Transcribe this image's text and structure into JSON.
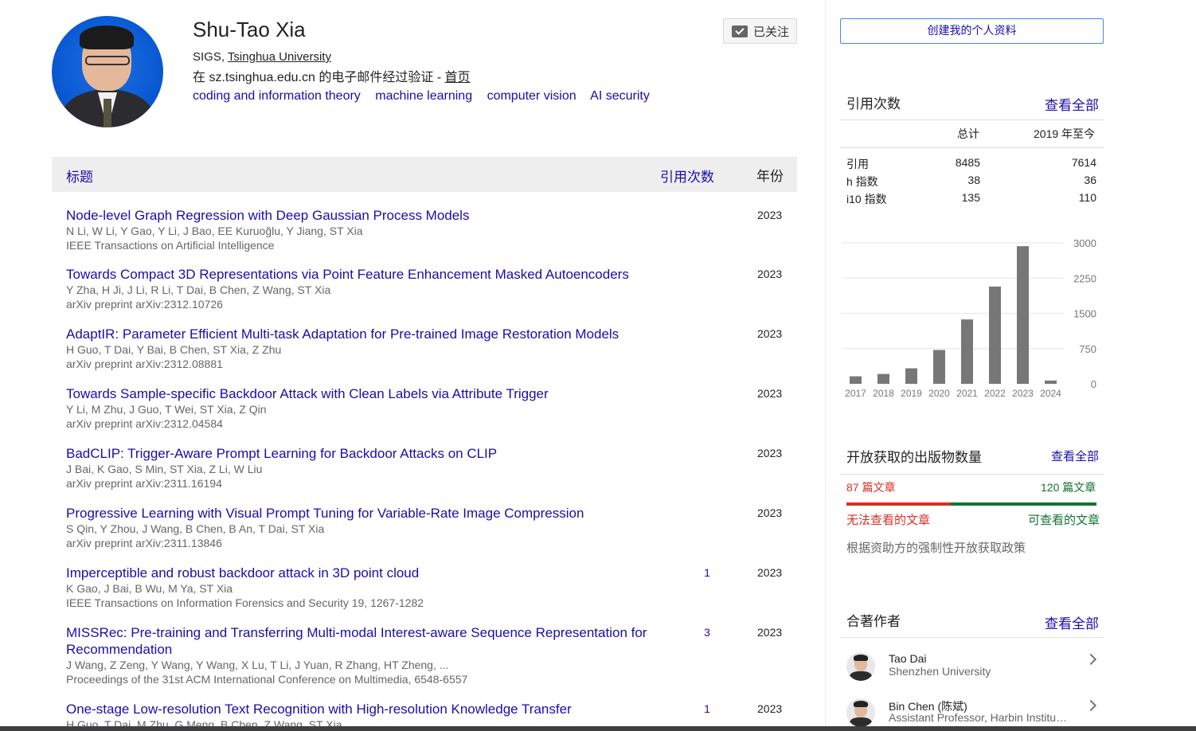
{
  "profile": {
    "name": "Shu-Tao Xia",
    "affiliation_prefix": "SIGS, ",
    "affiliation_link": "Tsinghua University",
    "verified_text": "在 sz.tsinghua.edu.cn 的电子邮件经过验证 - ",
    "homepage_link": "首页",
    "interests": [
      "coding and information theory",
      "machine learning",
      "computer vision",
      "AI security"
    ],
    "follow_label": "已关注"
  },
  "table": {
    "col_title": "标题",
    "col_citations": "引用次数",
    "col_year": "年份",
    "rows": [
      {
        "title": "Node-level Graph Regression with Deep Gaussian Process Models",
        "authors": "N Li, W Li, Y Gao, Y Li, J Bao, EE Kuruoğlu, Y Jiang, ST Xia",
        "venue": "IEEE Transactions on Artificial Intelligence",
        "citations": "",
        "year": "2023"
      },
      {
        "title": "Towards Compact 3D Representations via Point Feature Enhancement Masked Autoencoders",
        "authors": "Y Zha, H Ji, J Li, R Li, T Dai, B Chen, Z Wang, ST Xia",
        "venue": "arXiv preprint arXiv:2312.10726",
        "citations": "",
        "year": "2023"
      },
      {
        "title": "AdaptIR: Parameter Efficient Multi-task Adaptation for Pre-trained Image Restoration Models",
        "authors": "H Guo, T Dai, Y Bai, B Chen, ST Xia, Z Zhu",
        "venue": "arXiv preprint arXiv:2312.08881",
        "citations": "",
        "year": "2023"
      },
      {
        "title": "Towards Sample-specific Backdoor Attack with Clean Labels via Attribute Trigger",
        "authors": "Y Li, M Zhu, J Guo, T Wei, ST Xia, Z Qin",
        "venue": "arXiv preprint arXiv:2312.04584",
        "citations": "",
        "year": "2023"
      },
      {
        "title": "BadCLIP: Trigger-Aware Prompt Learning for Backdoor Attacks on CLIP",
        "authors": "J Bai, K Gao, S Min, ST Xia, Z Li, W Liu",
        "venue": "arXiv preprint arXiv:2311.16194",
        "citations": "",
        "year": "2023"
      },
      {
        "title": "Progressive Learning with Visual Prompt Tuning for Variable-Rate Image Compression",
        "authors": "S Qin, Y Zhou, J Wang, B Chen, B An, T Dai, ST Xia",
        "venue": "arXiv preprint arXiv:2311.13846",
        "citations": "",
        "year": "2023"
      },
      {
        "title": "Imperceptible and robust backdoor attack in 3D point cloud",
        "authors": "K Gao, J Bai, B Wu, M Ya, ST Xia",
        "venue": "IEEE Transactions on Information Forensics and Security 19, 1267-1282",
        "citations": "1",
        "year": "2023"
      },
      {
        "title": "MISSRec: Pre-training and Transferring Multi-modal Interest-aware Sequence Representation for Recommendation",
        "authors": "J Wang, Z Zeng, Y Wang, Y Wang, X Lu, T Li, J Yuan, R Zhang, HT Zheng, ...",
        "venue": "Proceedings of the 31st ACM International Conference on Multimedia, 6548-6557",
        "citations": "3",
        "year": "2023"
      },
      {
        "title": "One-stage Low-resolution Text Recognition with High-resolution Knowledge Transfer",
        "authors": "H Guo, T Dai, M Zhu, G Meng, B Chen, Z Wang, ST Xia",
        "venue": "",
        "citations": "1",
        "year": "2023"
      }
    ]
  },
  "sidebar": {
    "create_profile": "创建我的个人资料",
    "citations": {
      "title": "引用次数",
      "view_all": "查看全部",
      "col_total": "总计",
      "col_since": "2019 年至今",
      "rows": [
        {
          "label": "引用",
          "total": "8485",
          "since": "7614"
        },
        {
          "label": "h 指数",
          "total": "38",
          "since": "36"
        },
        {
          "label": "i10 指数",
          "total": "135",
          "since": "110"
        }
      ]
    },
    "open_access": {
      "title": "开放获取的出版物数量",
      "view_all": "查看全部",
      "unavailable_count": "87 篇文章",
      "available_count": "120 篇文章",
      "unavailable_label": "无法查看的文章",
      "available_label": "可查看的文章",
      "mandate_text": "根据资助方的强制性开放获取政策",
      "unavailable_fraction": 0.42
    },
    "coauthors": {
      "title": "合著作者",
      "view_all": "查看全部",
      "people": [
        {
          "name": "Tao Dai",
          "affiliation": "Shenzhen University"
        },
        {
          "name": "Bin Chen (陈斌)",
          "affiliation": "Assistant Professor, Harbin Institute of Technology"
        }
      ]
    }
  },
  "colors": {
    "link": "#1a0dab",
    "bar": "#777777",
    "red": "#d93025",
    "green": "#137333"
  },
  "chart_data": {
    "type": "bar",
    "categories": [
      "2017",
      "2018",
      "2019",
      "2020",
      "2021",
      "2022",
      "2023",
      "2024"
    ],
    "values": [
      160,
      210,
      330,
      720,
      1370,
      2070,
      2930,
      70
    ],
    "ylim": [
      0,
      3000
    ],
    "yticks": [
      "0",
      "750",
      "1500",
      "2250",
      "3000"
    ],
    "grid": true
  }
}
